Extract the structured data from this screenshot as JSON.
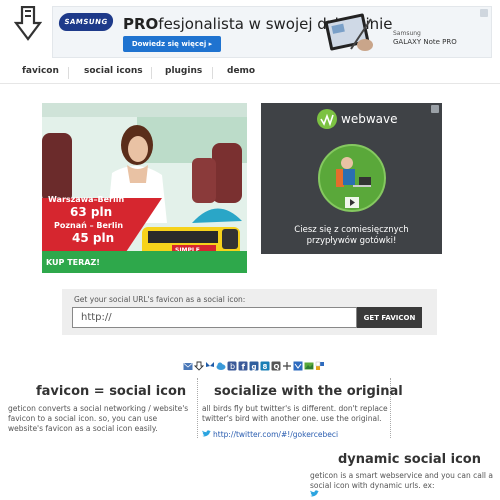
{
  "header": {
    "ad": {
      "brand_logo": "SAMSUNG",
      "headline_bold": "PRO",
      "headline_rest": "fesjonalista w swojej dziedzinie",
      "button": "Dowiedz się więcej  ▸",
      "product_brand": "Samsung",
      "product_name": "GALAXY Note PRO"
    }
  },
  "nav": {
    "items": [
      {
        "label": "favicon"
      },
      {
        "label": "social icons"
      },
      {
        "label": "plugins"
      },
      {
        "label": "demo"
      }
    ]
  },
  "bus_ad": {
    "route1": "Warszawa–Berlin",
    "price1": "63 pln",
    "route2": "Poznań – Berlin",
    "price2": "45 pln",
    "cta": "KUP TERAZ!",
    "bus_brand": "SIMPLE EXPRESS",
    "colors": {
      "red": "#d6262f",
      "green": "#2ea84b",
      "yellow": "#f6d21b"
    }
  },
  "webwave_ad": {
    "brand": "webwave",
    "tagline_line1": "Ciesz się z comiesięcznych",
    "tagline_line2": "przypływów gotówki!"
  },
  "form": {
    "label": "Get your social URL's favicon as a social icon:",
    "input_value": "http://",
    "button": "GET FAVICON"
  },
  "social_icons": [
    "mail-icon",
    "download-icon",
    "butterfly-icon",
    "cloud-icon",
    "blogger-icon",
    "facebook-icon",
    "g-icon",
    "vimeo-icon",
    "google-plus-icon",
    "delicious-icon",
    "wordpress-icon",
    "photo-icon",
    "puzzle-icon"
  ],
  "columns": {
    "col1": {
      "title": "favicon = social icon",
      "text": "geticon converts a social networking / website's favicon to a social icon. so, you can use website's favicon as a social icon easily."
    },
    "col2": {
      "title": "socialize with the original",
      "text": "all birds fly but twitter's is different. don't replace twitter's bird with another one. use the original.",
      "link": "http://twitter.com/#!/gokercebeci"
    },
    "col3": {
      "title": "dynamic social icon",
      "text": "geticon is a smart webservice and you can call a social icon with dynamic urls. ex:"
    }
  }
}
